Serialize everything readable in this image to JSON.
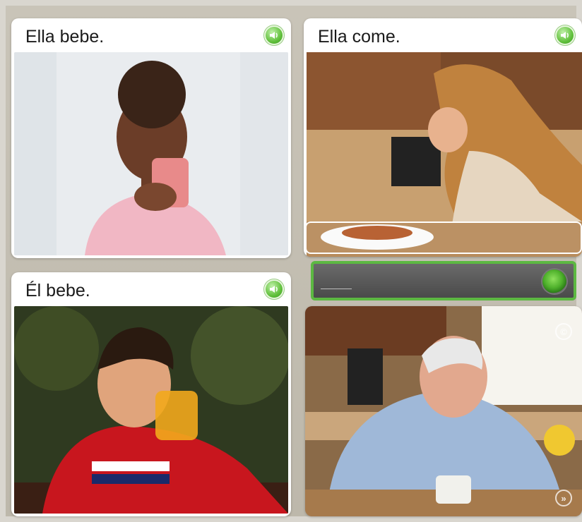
{
  "cards": [
    {
      "caption": "Ella bebe.",
      "photo": "woman drinking from a pink mug",
      "audio_icon": "speaker-icon"
    },
    {
      "caption": "Ella come.",
      "photo": "woman eating with a fork in a kitchen",
      "audio_icon": "speaker-icon"
    },
    {
      "caption": "Él bebe.",
      "photo": "boy drinking orange juice",
      "audio_icon": "speaker-icon"
    },
    {
      "caption": "",
      "photo": "older man eating from a bowl",
      "audio_icon": ""
    }
  ],
  "answer": {
    "value": "",
    "mic_icon": "microphone-icon"
  },
  "overlay_icons": {
    "copyright": "©",
    "next": "»"
  },
  "colors": {
    "accent": "#5cb842",
    "answer_bg": "#555555",
    "card_bg": "#ffffff"
  }
}
